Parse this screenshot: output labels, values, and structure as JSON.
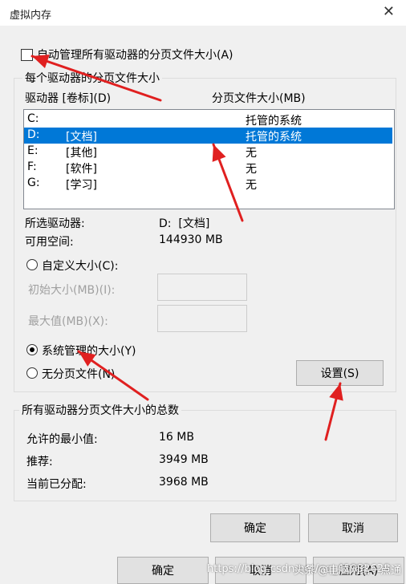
{
  "window": {
    "title": "虚拟内存",
    "close_glyph": "✕"
  },
  "auto_manage": {
    "label": "自动管理所有驱动器的分页文件大小(A)",
    "checked": false
  },
  "per_drive": {
    "group_title": "每个驱动器的分页文件大小",
    "col_drive": "驱动器 [卷标](D)",
    "col_size": "分页文件大小(MB)",
    "drives": [
      {
        "letter": "C:",
        "label": "",
        "size": "托管的系统",
        "selected": false
      },
      {
        "letter": "D:",
        "label": "[文档]",
        "size": "托管的系统",
        "selected": true
      },
      {
        "letter": "E:",
        "label": "[其他]",
        "size": "无",
        "selected": false
      },
      {
        "letter": "F:",
        "label": "[软件]",
        "size": "无",
        "selected": false
      },
      {
        "letter": "G:",
        "label": "[学习]",
        "size": "无",
        "selected": false
      }
    ],
    "selected_drive_label": "所选驱动器:",
    "selected_drive_value": "D:  [文档]",
    "free_space_label": "可用空间:",
    "free_space_value": "144930 MB",
    "custom_size_label": "自定义大小(C):",
    "initial_size_label": "初始大小(MB)(I):",
    "initial_size_value": "",
    "max_size_label": "最大值(MB)(X):",
    "max_size_value": "",
    "system_managed_label": "系统管理的大小(Y)",
    "no_paging_label": "无分页文件(N)",
    "selected_option": "system_managed",
    "set_button": "设置(S)"
  },
  "totals": {
    "group_title": "所有驱动器分页文件大小的总数",
    "min_label": "允许的最小值:",
    "min_value": "16 MB",
    "recommended_label": "推荐:",
    "recommended_value": "3949 MB",
    "allocated_label": "当前已分配:",
    "allocated_value": "3968 MB"
  },
  "buttons": {
    "ok": "确定",
    "cancel": "取消"
  },
  "background_buttons": {
    "ok": "确定",
    "cancel": "取消",
    "apply": "应用(A)"
  },
  "overlay": {
    "arrow_color": "#e02020"
  },
  "watermark": {
    "source": "头条 @电脑网络一点通",
    "url": "https://blog.csdn.net/qq_41982628"
  }
}
